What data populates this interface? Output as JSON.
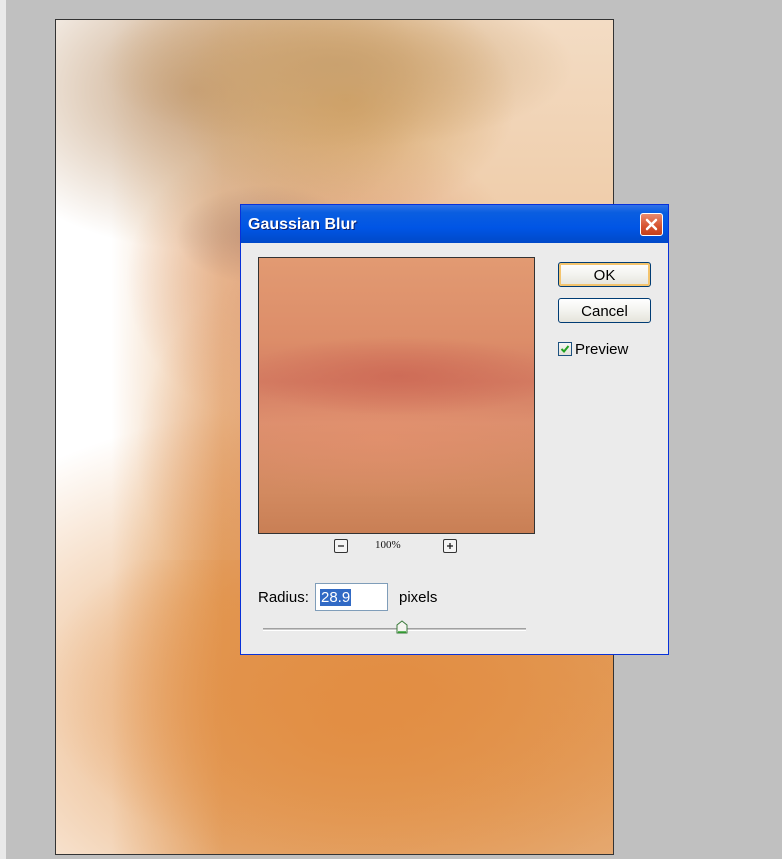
{
  "dialog": {
    "title": "Gaussian Blur",
    "ok_label": "OK",
    "cancel_label": "Cancel",
    "preview_label": "Preview",
    "preview_checked": true,
    "zoom_level": "100%",
    "radius_label": "Radius:",
    "radius_value": "28.9",
    "units_label": "pixels",
    "radius_slider_fraction": 0.53
  },
  "colors": {
    "titlebar": "#0055e5",
    "close_button": "#d6522e",
    "ok_focus": "#f4c46d",
    "selection": "#316ac5",
    "checkmark": "#21a121"
  },
  "icons": {
    "close": "close-icon",
    "zoom_out": "minus-icon",
    "zoom_in": "plus-icon",
    "check": "checkmark-icon"
  }
}
